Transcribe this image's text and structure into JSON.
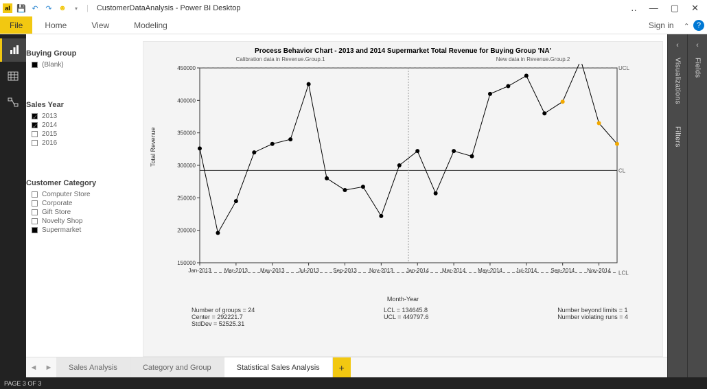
{
  "window": {
    "title": "CustomerDataAnalysis - Power BI Desktop",
    "minimize": "—",
    "restore": "▢",
    "close": "✕",
    "more": "‥"
  },
  "qat": {
    "save_icon": "save-icon",
    "undo_icon": "undo-icon",
    "redo_icon": "redo-icon",
    "smiley_icon": "smiley-icon"
  },
  "ribbon": {
    "file": "File",
    "tabs": [
      "Home",
      "View",
      "Modeling"
    ],
    "signin": "Sign in",
    "chevron": "⌄"
  },
  "nav_rail": {
    "items": [
      "report-view-icon",
      "data-view-icon",
      "model-view-icon"
    ]
  },
  "filters": {
    "group_title": "Buying Group",
    "group_items": [
      {
        "label": "(Blank)",
        "checked": true
      }
    ],
    "year_title": "Sales Year",
    "year_items": [
      {
        "label": "2013",
        "checked": true
      },
      {
        "label": "2014",
        "checked": true
      },
      {
        "label": "2015",
        "checked": false
      },
      {
        "label": "2016",
        "checked": false
      }
    ],
    "cat_title": "Customer Category",
    "cat_items": [
      {
        "label": "Computer Store",
        "checked": false
      },
      {
        "label": "Corporate",
        "checked": false
      },
      {
        "label": "Gift Store",
        "checked": false
      },
      {
        "label": "Novelty Shop",
        "checked": false
      },
      {
        "label": "Supermarket",
        "checked": true
      }
    ]
  },
  "chart_data": {
    "type": "line",
    "title": "Process Behavior Chart - 2013 and 2014 Supermarket Total Revenue for Buying Group 'NA'",
    "sublabels": [
      "Calibration data in Revenue.Group.1",
      "New data in Revenue.Group.2"
    ],
    "ylabel": "Total Revenue",
    "xlabel": "Month-Year",
    "ylim": [
      150000,
      450000
    ],
    "x_ticks": [
      "Jan-2013",
      "Mar-2013",
      "May-2013",
      "Jul-2013",
      "Sep-2013",
      "Nov-2013",
      "Jan-2014",
      "Mar-2014",
      "May-2014",
      "Jul-2014",
      "Sep-2014",
      "Nov-2014"
    ],
    "y_ticks": [
      150000,
      200000,
      250000,
      300000,
      350000,
      400000,
      450000
    ],
    "center": 292221.7,
    "ucl": 449797.6,
    "lcl": 134645.8,
    "split_index": 12,
    "line_labels": {
      "ucl": "UCL",
      "cl": "CL",
      "lcl": "LCL"
    },
    "series": [
      {
        "name": "Total Revenue",
        "x": [
          "Jan-2013",
          "Feb-2013",
          "Mar-2013",
          "Apr-2013",
          "May-2013",
          "Jun-2013",
          "Jul-2013",
          "Aug-2013",
          "Sep-2013",
          "Oct-2013",
          "Nov-2013",
          "Dec-2013",
          "Jan-2014",
          "Feb-2014",
          "Mar-2014",
          "Apr-2014",
          "May-2014",
          "Jun-2014",
          "Jul-2014",
          "Aug-2014",
          "Sep-2014",
          "Oct-2014",
          "Nov-2014",
          "Dec-2014"
        ],
        "values": [
          326000,
          196000,
          245000,
          320000,
          333000,
          340000,
          425000,
          280000,
          262000,
          267000,
          222000,
          300000,
          322000,
          257000,
          322000,
          314000,
          410000,
          422000,
          438000,
          380000,
          398000,
          462000,
          365000,
          333000
        ],
        "point_flags": [
          "n",
          "n",
          "n",
          "n",
          "n",
          "n",
          "n",
          "n",
          "n",
          "n",
          "n",
          "n",
          "n",
          "n",
          "n",
          "n",
          "n",
          "n",
          "n",
          "n",
          "r",
          "x",
          "r",
          "r"
        ]
      }
    ],
    "stats": {
      "left": [
        "Number of groups = 24",
        "Center = 292221.7",
        "StdDev = 52525.31"
      ],
      "mid": [
        "LCL = 134645.8",
        "UCL = 449797.6"
      ],
      "right": [
        "Number beyond limits = 1",
        "Number violating runs = 4"
      ]
    }
  },
  "right_panes": {
    "panes": [
      "Visualizations",
      "Fields"
    ],
    "sub": "Filters"
  },
  "page_tabs": {
    "tabs": [
      {
        "label": "Sales Analysis",
        "active": false
      },
      {
        "label": "Category and Group",
        "active": false
      },
      {
        "label": "Statistical Sales Analysis",
        "active": true
      }
    ],
    "add": "+"
  },
  "status": {
    "page": "PAGE 3 OF 3"
  }
}
